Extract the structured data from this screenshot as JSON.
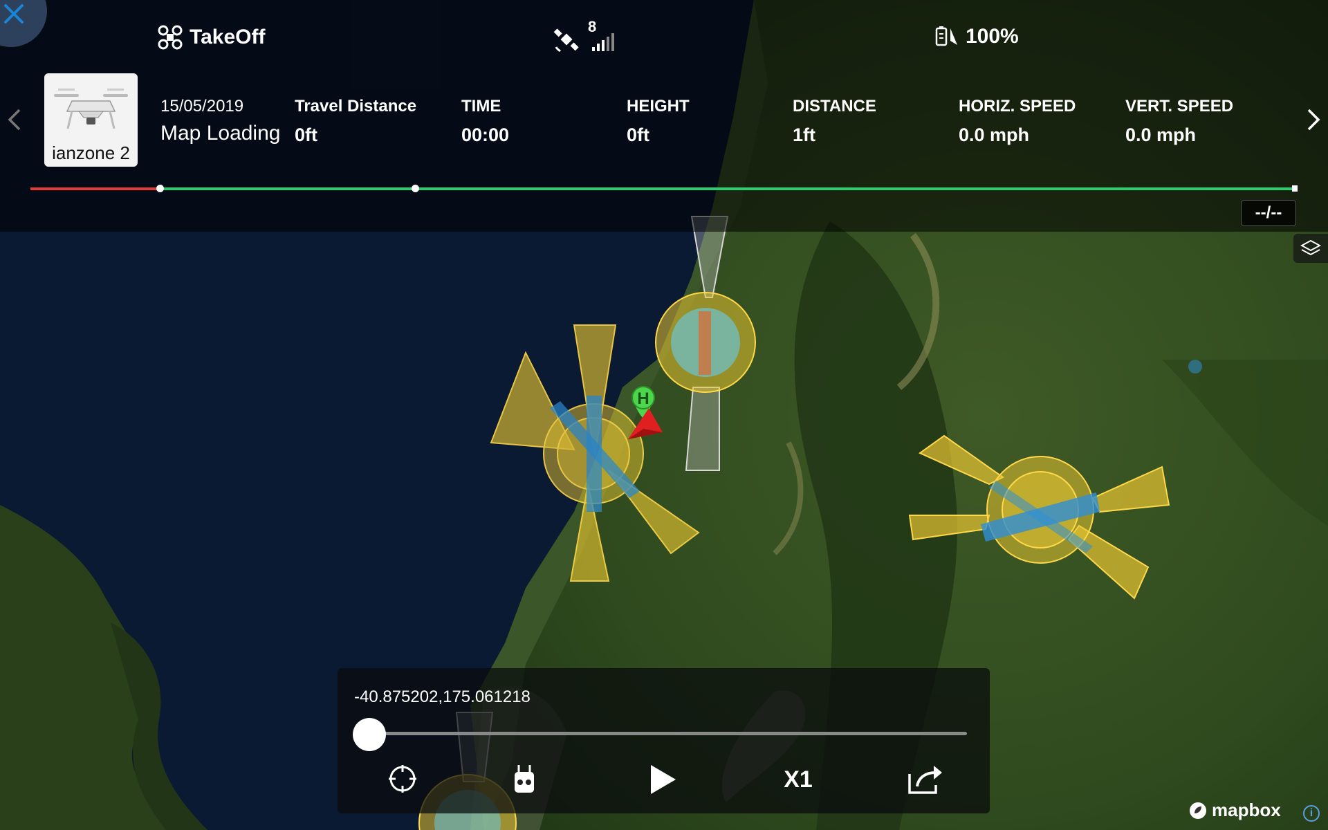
{
  "status": {
    "mode_label": "TakeOff",
    "satellite_count": "8",
    "battery_label": "100%"
  },
  "aircraft": {
    "name": "ianzone 2"
  },
  "flight": {
    "date": "15/05/2019",
    "title": "Map Loading",
    "stats": [
      {
        "label": "Travel Distance",
        "value": "0ft"
      },
      {
        "label": "TIME",
        "value": "00:00"
      },
      {
        "label": "HEIGHT",
        "value": "0ft"
      },
      {
        "label": "DISTANCE",
        "value": "1ft"
      },
      {
        "label": "HORIZ. SPEED",
        "value": "0.0 mph"
      },
      {
        "label": "VERT. SPEED",
        "value": "0.0 mph"
      }
    ]
  },
  "timeline": {
    "time_chip": "--/--"
  },
  "playback": {
    "coordinates": "-40.875202,175.061218",
    "position": 0,
    "speed_label": "X1"
  },
  "map": {
    "home_marker": "H",
    "attribution": "mapbox",
    "info": "i"
  },
  "colors": {
    "timeline_elapsed": "#e23b3b",
    "timeline_remaining": "#2ecc71",
    "zone_yellow": "#e8c531",
    "zone_blue": "#2e8fd6",
    "home_green": "#4cd64c",
    "aircraft_red": "#e02020"
  }
}
